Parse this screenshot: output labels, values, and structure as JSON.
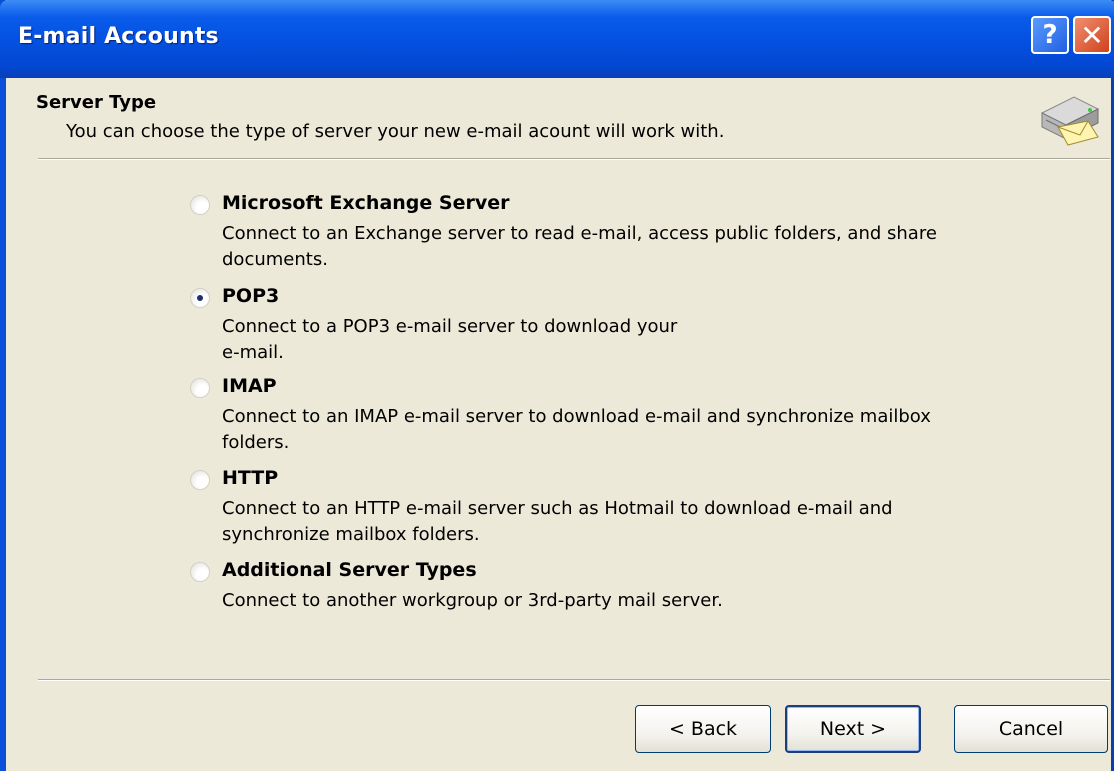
{
  "window": {
    "title": "E-mail Accounts",
    "help_glyph": "?",
    "close_glyph": "✕"
  },
  "header": {
    "title": "Server Type",
    "description": "You can choose the type of server your new e-mail acount will work with.",
    "icon": "server-mail-icon"
  },
  "options": [
    {
      "label": "Microsoft Exchange Server",
      "description": "Connect to an Exchange server to read e-mail, access public folders, and share documents.",
      "checked": false
    },
    {
      "label": "POP3",
      "description": "Connect to a POP3 e-mail server to download your e-mail.",
      "checked": true
    },
    {
      "label": "IMAP",
      "description": "Connect to an IMAP e-mail server to download e-mail and synchronize mailbox folders.",
      "checked": false
    },
    {
      "label": "HTTP",
      "description": "Connect to an HTTP e-mail server such as Hotmail to download e-mail and synchronize mailbox folders.",
      "checked": false
    },
    {
      "label": "Additional Server Types",
      "description": "Connect to another workgroup or 3rd-party mail server.",
      "checked": false
    }
  ],
  "buttons": {
    "back": "< Back",
    "next": "Next >",
    "cancel": "Cancel"
  },
  "colors": {
    "titlebar": "#0450E0",
    "dialog_bg": "#ECE9D8",
    "close_button": "#D0401C"
  }
}
